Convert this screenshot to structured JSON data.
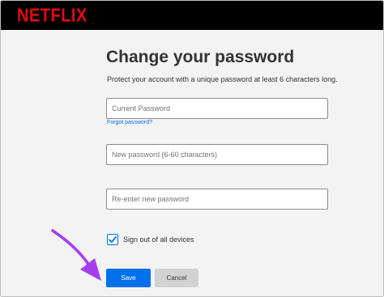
{
  "header": {
    "logo_text": "NETFLIX"
  },
  "form": {
    "title": "Change your password",
    "subtitle": "Protect your account with a unique password at least 6 characters long.",
    "current_password_placeholder": "Current Password",
    "forgot_password_link": "Forgot password?",
    "new_password_placeholder": "New password (6-60 characters)",
    "reenter_password_placeholder": "Re-enter new password",
    "signout_checkbox_label": "Sign out of all devices",
    "signout_checked": true,
    "save_label": "Save",
    "cancel_label": "Cancel"
  },
  "colors": {
    "brand_red": "#e50914",
    "accent_blue": "#0071eb",
    "arrow_purple": "#a63ef0"
  },
  "annotation": {
    "arrow_icon": "pointer-arrow-icon"
  }
}
